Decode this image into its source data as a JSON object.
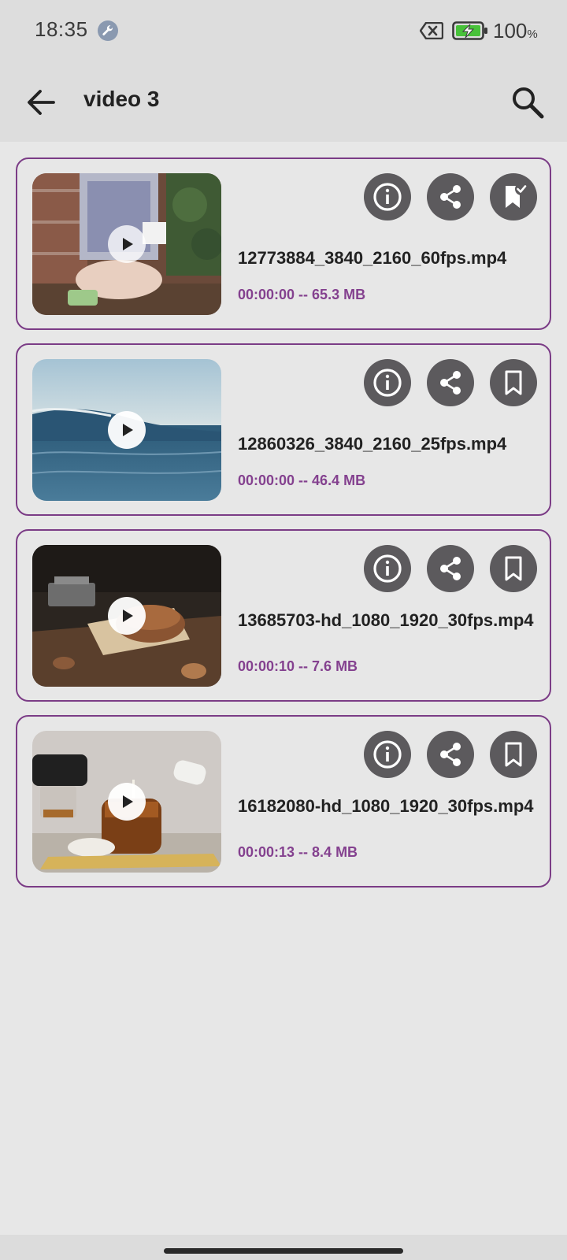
{
  "status_bar": {
    "time": "18:35",
    "battery_level": "100",
    "battery_unit": "%",
    "icons": [
      "wrench-icon",
      "sim-off-icon",
      "battery-charging-icon"
    ]
  },
  "app_bar": {
    "title": "video 3",
    "back_icon": "arrow-back-icon",
    "search_icon": "search-icon"
  },
  "colors": {
    "accent": "#84418f",
    "card_border": "#7b3c86",
    "action_button": "#5c5a5d",
    "background": "#e7e7e7",
    "app_bar": "#dddddd"
  },
  "videos": [
    {
      "file_name": "12773884_3840_2160_60fps.mp4",
      "meta": "00:00:00 -- 65.3 MB",
      "bookmarked": true
    },
    {
      "file_name": "12860326_3840_2160_25fps.mp4",
      "meta": "00:00:00 -- 46.4 MB",
      "bookmarked": false
    },
    {
      "file_name": "13685703-hd_1080_1920_30fps.mp4",
      "meta": "00:00:10 -- 7.6 MB",
      "bookmarked": false
    },
    {
      "file_name": "16182080-hd_1080_1920_30fps.mp4",
      "meta": "00:00:13 -- 8.4 MB",
      "bookmarked": false
    }
  ]
}
